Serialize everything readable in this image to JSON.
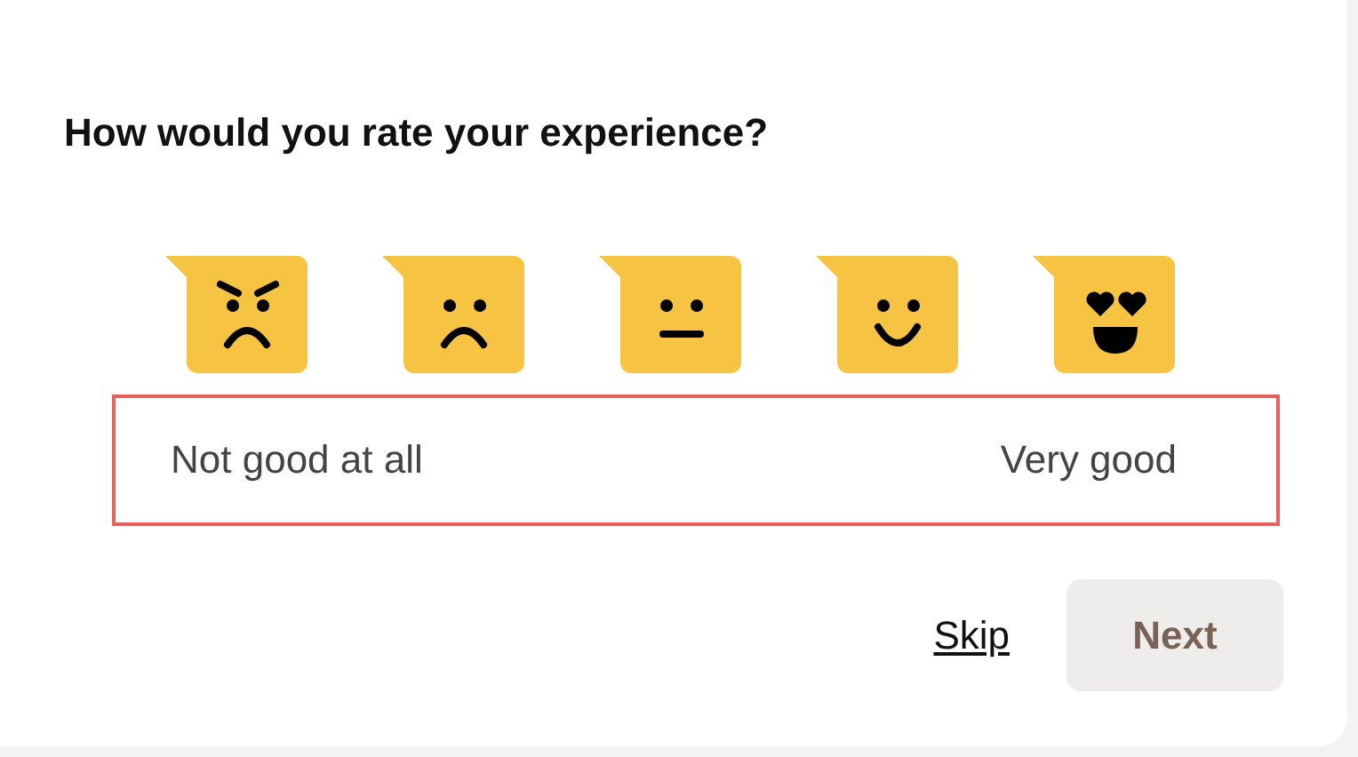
{
  "title": "How would you rate your experience?",
  "ratings": [
    {
      "kind": "angry"
    },
    {
      "kind": "sad"
    },
    {
      "kind": "neutral"
    },
    {
      "kind": "happy"
    },
    {
      "kind": "love"
    }
  ],
  "scale": {
    "low": "Not good at all",
    "high": "Very good"
  },
  "skip": {
    "label": "Skip"
  },
  "next": {
    "label": "Next",
    "disabled": true
  }
}
